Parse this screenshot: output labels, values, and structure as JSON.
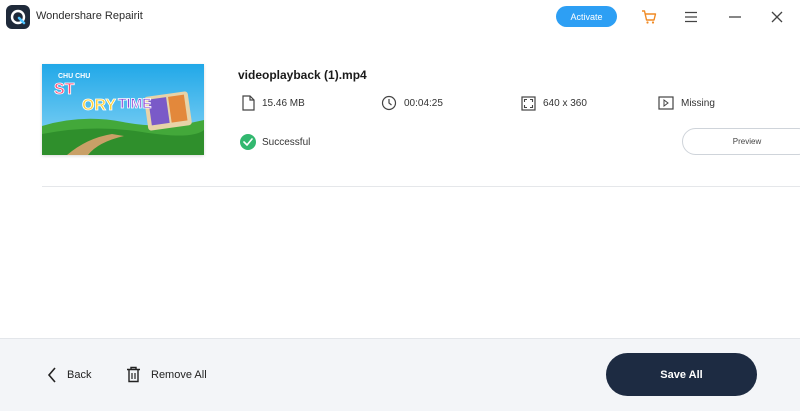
{
  "app": {
    "title": "Wondershare Repairit",
    "activate_label": "Activate"
  },
  "file": {
    "name": "videoplayback (1).mp4",
    "size": "15.46  MB",
    "duration": "00:04:25",
    "resolution": "640 x 360",
    "audio": "Missing",
    "status": "Successful",
    "preview_label": "Preview",
    "thumbnail_text": "CHU CHU"
  },
  "footer": {
    "back_label": "Back",
    "remove_all_label": "Remove All",
    "save_all_label": "Save All"
  },
  "colors": {
    "accent": "#2d9ff4",
    "success": "#32b86f",
    "save_button": "#1d2b42",
    "cart": "#f08a24"
  }
}
